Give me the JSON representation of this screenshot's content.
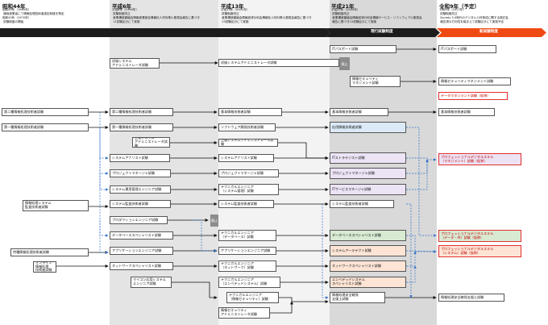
{
  "eras": [
    {
      "title": "昭和44年",
      "notes": "昭和44年（1969年）\n 通商産業省にて情報処理技術者認定制度を策定\n昭和45年（1970年）\n 試験制度の開始"
    },
    {
      "title": "平成6年",
      "notes": "平成6年（1994年）\n 試験制度改正\n 産業構造審議会情報産業部会情報化人材対策小委員会報告に基づき\n 11試験区分にて実施"
    },
    {
      "title": "平成13年",
      "notes": "平成13年（2001年）\n 試験制度改正\n 産業構造審議会情報経済分科会情報化人材対策小委員会報告に基づき\n 13試験区分にて実施"
    },
    {
      "title": "平成21年",
      "notes": "平成21年（2009年）\n 試験制度改正\n 産業構造審議会情報経済分科会情報サービス・ソフトウェア小委員会\n 報告に基づき12試験区分にて実施"
    },
    {
      "title": "令和9年（予定）",
      "notes": "令和9年（2027年）\n 試験制度改正\n Society 5.0時代のデジタル人材育成に関する検討会\n 報告書の方向性を踏まえて試験区分にて実施予定"
    }
  ],
  "bars": {
    "current": "現行試験制度",
    "new": "新試験制度"
  },
  "icons": {
    "arrow": "arrow-icon",
    "dashed_arrow": "dashed-arrow-icon"
  },
  "colors": {
    "dark": "#1c1c1c",
    "new": "#f04a14",
    "green": "#d9ead3",
    "purple": "#ece3f5",
    "orange": "#fde4d5",
    "blue": "#dce9f7",
    "dash": "#2f6fc8"
  },
  "abolished": [
    "廃止",
    "廃止"
  ],
  "exams": {
    "s44_1": "第二種情報処理技術者試験",
    "s44_2": "第一種情報処理技術者試験",
    "s44_3": "情報処理システム\n監査技術者試験",
    "s44_4": "特種情報処理技術者試験",
    "s44_5": "オンライン情報処理\n技術者試験",
    "h6_1": "初級システム\nアドミニストレータ試験",
    "h6_2": "第二種情報処理技術者試験",
    "h6_3": "第一種情報処理技術者試験",
    "h6_4": "上級システム\nアドミニストレータ試験",
    "h6_5": "システムアナリスト試験",
    "h6_6": "プロジェクトマネージャ試験",
    "h6_7": "システム運用管理エンジニア試験",
    "h6_8": "システム監査技術者試験",
    "h6_9": "プロダクションエンジニア試験",
    "h6_10": "データベーススペシャリスト試験",
    "h6_11": "アプリケーションエンジニア試験",
    "h6_12": "ネットワークスペシャリスト試験",
    "h6_13": "マイコン応用システム\nエンジニア試験",
    "h13_1": "初級システムアドミニストレータ試験",
    "h13_2": "基本情報技術者試験",
    "h13_3": "ソフトウェア開発技術者試験",
    "h13_4": "上級システムアドミニストレータ試験",
    "h13_5": "システムアナリスト試験",
    "h13_6": "プロジェクトマネージャ試験",
    "h13_7": "テクニカルエンジニア\n（システム管理）試験",
    "h13_8": "システム監査技術者試験",
    "h13_9": "テクニカルエンジニア\n（データベース）試験",
    "h13_10": "アプリケーションエンジニア試験",
    "h13_11": "テクニカルエンジニア\n（ネットワーク）試験",
    "h13_12": "テクニカルエンジニア\n（エンベデッドシステム）試験",
    "h13_13": "テクニカルエンジニア\n（情報セキュリティ）試験",
    "h13_14": "情報セキュリティ\nアドミニストレータ試験",
    "h21_1": "ITパスポート試験",
    "h21_2": "情報セキュリティ\nマネジメント試験",
    "h21_3": "基本情報技術者試験",
    "h21_4": "応用情報技術者試験",
    "h21_5": "ITストラテジスト試験",
    "h21_6": "プロジェクトマネージャ試験",
    "h21_7": "ITサービスマネージャ試験",
    "h21_8": "システム監査技術者試験",
    "h21_9": "データベーススペシャリスト試験",
    "h21_10": "システムアーキテクト試験",
    "h21_11": "ネットワークスペシャリスト試験",
    "h21_12": "エンベデッドシステム\nスペシャリスト試験",
    "h21_13": "情報処理安全確保\n支援士試験",
    "r9_1": "ITパスポート試験",
    "r9_2": "情報セキュリティマネジメント試験",
    "r9_3": "データマネジメント試験（仮称）",
    "r9_4": "基本情報技術者試験",
    "r9_5": "プロフェッショナルデジタルスキル\n（マネジメント）試験（仮称）",
    "r9_6": "プロフェッショナルデジタルスキル\n（データ・AI）試験（仮称）",
    "r9_7": "プロフェッショナルデジタルスキル\n（システム）試験（仮称）",
    "r9_8": "情報処理安全確保支援士試験"
  }
}
